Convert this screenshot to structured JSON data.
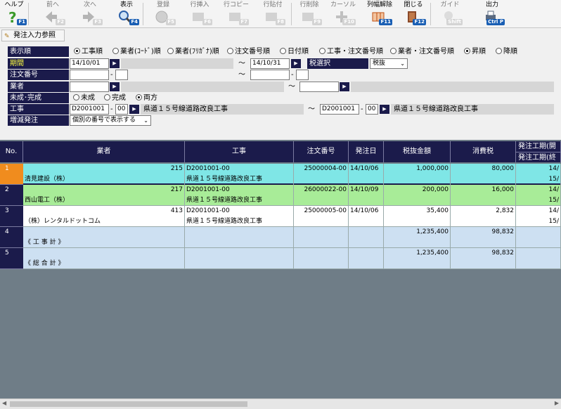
{
  "toolbar": {
    "items": [
      {
        "label": "ヘルプ",
        "key": "F1"
      },
      {
        "label": "前へ",
        "key": "F2"
      },
      {
        "label": "次へ",
        "key": "F3"
      },
      {
        "label": "表示",
        "key": "F4"
      },
      {
        "label": "登録",
        "key": "F5"
      },
      {
        "label": "行挿入",
        "key": "F6"
      },
      {
        "label": "行コピー",
        "key": "F7"
      },
      {
        "label": "行貼付",
        "key": "F8"
      },
      {
        "label": "行削除",
        "key": "F9"
      },
      {
        "label": "カーソル",
        "key": "F10"
      },
      {
        "label": "列幅解除",
        "key": "F11"
      },
      {
        "label": "閉じる",
        "key": "F12"
      },
      {
        "label": "ガイド",
        "key": "Shift"
      },
      {
        "label": "出力",
        "key": "Ctrl P"
      }
    ]
  },
  "ref_button": "発注入力参照",
  "form": {
    "order_label": "表示順",
    "order_opts": [
      "工事順",
      "業者(ｺｰﾄﾞ)順",
      "業者(ﾌﾘｶﾞﾅ)順",
      "注文番号順",
      "日付順",
      "工事・注文番号順",
      "業者・注文番号順"
    ],
    "sort_opts": [
      "昇順",
      "降順"
    ],
    "period_label": "期間",
    "period_from": "14/10/01",
    "period_to": "14/10/31",
    "tilde": "～",
    "tax_label": "税選択",
    "tax_value": "税抜",
    "order_no_label": "注文番号",
    "dash": "-",
    "vendor_label": "業者",
    "status_label": "未成･完成",
    "status_opts": [
      "未成",
      "完成",
      "両方"
    ],
    "project_label": "工事",
    "project_from_code": "D2001001",
    "project_from_sub": "00",
    "project_from_name": "県道１５号線道路改良工事",
    "project_to_code": "D2001001",
    "project_to_sub": "00",
    "project_to_name": "県道１５号線道路改良工事",
    "incdec_label": "増減発注",
    "incdec_value": "個別の番号で表示する"
  },
  "grid": {
    "headers": [
      "No.",
      "業者",
      "工事",
      "注文番号",
      "発注日",
      "税抜金額",
      "消費税",
      "発注工期(開",
      "発注工期(終"
    ],
    "rows": [
      {
        "no": "1",
        "vendor_code": "215",
        "project_code": "D2001001-00",
        "order_no": "25000004-00",
        "date": "14/10/06",
        "amount": "1,000,000",
        "tax": "80,000",
        "p1": "14/",
        "vendor_name": "清見建設（株）",
        "project_name": "県道１５号線道路改良工事",
        "p2": "15/"
      },
      {
        "no": "2",
        "vendor_code": "217",
        "project_code": "D2001001-00",
        "order_no": "26000022-00",
        "date": "14/10/09",
        "amount": "200,000",
        "tax": "16,000",
        "p1": "14/",
        "vendor_name": "西山電工（株）",
        "project_name": "県道１５号線道路改良工事",
        "p2": "15/"
      },
      {
        "no": "3",
        "vendor_code": "413",
        "project_code": "D2001001-00",
        "order_no": "25000005-00",
        "date": "14/10/06",
        "amount": "35,400",
        "tax": "2,832",
        "p1": "14/",
        "vendor_name": "（株）レンタルドットコム",
        "project_name": "県道１５号線道路改良工事",
        "p2": "15/"
      },
      {
        "no": "4",
        "vendor_code": "",
        "project_code": "",
        "order_no": "",
        "date": "",
        "amount": "1,235,400",
        "tax": "98,832",
        "p1": "",
        "vendor_name": "《 工 事 計 》",
        "project_name": "",
        "p2": ""
      },
      {
        "no": "5",
        "vendor_code": "",
        "project_code": "",
        "order_no": "",
        "date": "",
        "amount": "1,235,400",
        "tax": "98,832",
        "p1": "",
        "vendor_name": "《 総 合 計 》",
        "project_name": "",
        "p2": ""
      }
    ]
  },
  "colors": {
    "header_bg": "#1b1b4b",
    "row1": "#7fe6e6",
    "row2": "#a8ec98",
    "row3": "#ffffff",
    "row45": "#cde0f2",
    "selected_no": "#f08c1e"
  }
}
